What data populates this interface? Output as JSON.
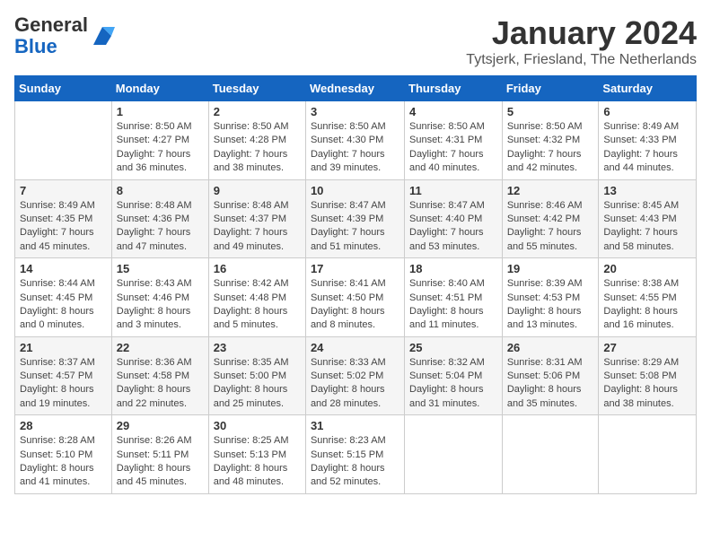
{
  "header": {
    "logo_general": "General",
    "logo_blue": "Blue",
    "month_title": "January 2024",
    "location": "Tytsjerk, Friesland, The Netherlands"
  },
  "weekdays": [
    "Sunday",
    "Monday",
    "Tuesday",
    "Wednesday",
    "Thursday",
    "Friday",
    "Saturday"
  ],
  "weeks": [
    [
      {
        "day": "",
        "info": ""
      },
      {
        "day": "1",
        "info": "Sunrise: 8:50 AM\nSunset: 4:27 PM\nDaylight: 7 hours\nand 36 minutes."
      },
      {
        "day": "2",
        "info": "Sunrise: 8:50 AM\nSunset: 4:28 PM\nDaylight: 7 hours\nand 38 minutes."
      },
      {
        "day": "3",
        "info": "Sunrise: 8:50 AM\nSunset: 4:30 PM\nDaylight: 7 hours\nand 39 minutes."
      },
      {
        "day": "4",
        "info": "Sunrise: 8:50 AM\nSunset: 4:31 PM\nDaylight: 7 hours\nand 40 minutes."
      },
      {
        "day": "5",
        "info": "Sunrise: 8:50 AM\nSunset: 4:32 PM\nDaylight: 7 hours\nand 42 minutes."
      },
      {
        "day": "6",
        "info": "Sunrise: 8:49 AM\nSunset: 4:33 PM\nDaylight: 7 hours\nand 44 minutes."
      }
    ],
    [
      {
        "day": "7",
        "info": "Sunrise: 8:49 AM\nSunset: 4:35 PM\nDaylight: 7 hours\nand 45 minutes."
      },
      {
        "day": "8",
        "info": "Sunrise: 8:48 AM\nSunset: 4:36 PM\nDaylight: 7 hours\nand 47 minutes."
      },
      {
        "day": "9",
        "info": "Sunrise: 8:48 AM\nSunset: 4:37 PM\nDaylight: 7 hours\nand 49 minutes."
      },
      {
        "day": "10",
        "info": "Sunrise: 8:47 AM\nSunset: 4:39 PM\nDaylight: 7 hours\nand 51 minutes."
      },
      {
        "day": "11",
        "info": "Sunrise: 8:47 AM\nSunset: 4:40 PM\nDaylight: 7 hours\nand 53 minutes."
      },
      {
        "day": "12",
        "info": "Sunrise: 8:46 AM\nSunset: 4:42 PM\nDaylight: 7 hours\nand 55 minutes."
      },
      {
        "day": "13",
        "info": "Sunrise: 8:45 AM\nSunset: 4:43 PM\nDaylight: 7 hours\nand 58 minutes."
      }
    ],
    [
      {
        "day": "14",
        "info": "Sunrise: 8:44 AM\nSunset: 4:45 PM\nDaylight: 8 hours\nand 0 minutes."
      },
      {
        "day": "15",
        "info": "Sunrise: 8:43 AM\nSunset: 4:46 PM\nDaylight: 8 hours\nand 3 minutes."
      },
      {
        "day": "16",
        "info": "Sunrise: 8:42 AM\nSunset: 4:48 PM\nDaylight: 8 hours\nand 5 minutes."
      },
      {
        "day": "17",
        "info": "Sunrise: 8:41 AM\nSunset: 4:50 PM\nDaylight: 8 hours\nand 8 minutes."
      },
      {
        "day": "18",
        "info": "Sunrise: 8:40 AM\nSunset: 4:51 PM\nDaylight: 8 hours\nand 11 minutes."
      },
      {
        "day": "19",
        "info": "Sunrise: 8:39 AM\nSunset: 4:53 PM\nDaylight: 8 hours\nand 13 minutes."
      },
      {
        "day": "20",
        "info": "Sunrise: 8:38 AM\nSunset: 4:55 PM\nDaylight: 8 hours\nand 16 minutes."
      }
    ],
    [
      {
        "day": "21",
        "info": "Sunrise: 8:37 AM\nSunset: 4:57 PM\nDaylight: 8 hours\nand 19 minutes."
      },
      {
        "day": "22",
        "info": "Sunrise: 8:36 AM\nSunset: 4:58 PM\nDaylight: 8 hours\nand 22 minutes."
      },
      {
        "day": "23",
        "info": "Sunrise: 8:35 AM\nSunset: 5:00 PM\nDaylight: 8 hours\nand 25 minutes."
      },
      {
        "day": "24",
        "info": "Sunrise: 8:33 AM\nSunset: 5:02 PM\nDaylight: 8 hours\nand 28 minutes."
      },
      {
        "day": "25",
        "info": "Sunrise: 8:32 AM\nSunset: 5:04 PM\nDaylight: 8 hours\nand 31 minutes."
      },
      {
        "day": "26",
        "info": "Sunrise: 8:31 AM\nSunset: 5:06 PM\nDaylight: 8 hours\nand 35 minutes."
      },
      {
        "day": "27",
        "info": "Sunrise: 8:29 AM\nSunset: 5:08 PM\nDaylight: 8 hours\nand 38 minutes."
      }
    ],
    [
      {
        "day": "28",
        "info": "Sunrise: 8:28 AM\nSunset: 5:10 PM\nDaylight: 8 hours\nand 41 minutes."
      },
      {
        "day": "29",
        "info": "Sunrise: 8:26 AM\nSunset: 5:11 PM\nDaylight: 8 hours\nand 45 minutes."
      },
      {
        "day": "30",
        "info": "Sunrise: 8:25 AM\nSunset: 5:13 PM\nDaylight: 8 hours\nand 48 minutes."
      },
      {
        "day": "31",
        "info": "Sunrise: 8:23 AM\nSunset: 5:15 PM\nDaylight: 8 hours\nand 52 minutes."
      },
      {
        "day": "",
        "info": ""
      },
      {
        "day": "",
        "info": ""
      },
      {
        "day": "",
        "info": ""
      }
    ]
  ]
}
